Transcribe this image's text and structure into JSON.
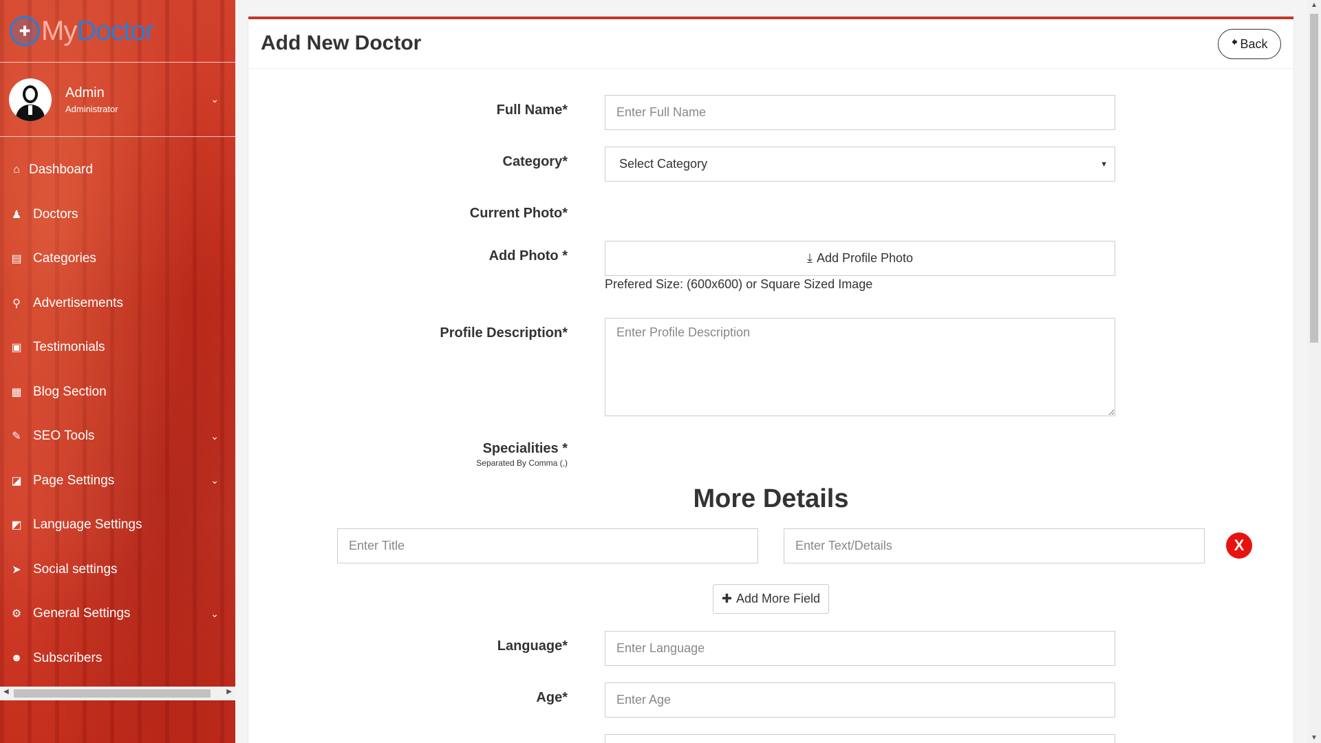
{
  "brand": {
    "logo_part1": "My",
    "logo_part2": "Doctor"
  },
  "user": {
    "name": "Admin",
    "role": "Administrator"
  },
  "sidebar": {
    "items": [
      {
        "label": "Dashboard",
        "icon": "home-icon",
        "glyph": "⌂",
        "has_arrow": false
      },
      {
        "label": "Doctors",
        "icon": "doctor-icon",
        "glyph": "♟",
        "has_arrow": false
      },
      {
        "label": "Categories",
        "icon": "clipboard-icon",
        "glyph": "▤",
        "has_arrow": false
      },
      {
        "label": "Advertisements",
        "icon": "link-icon",
        "glyph": "⚲",
        "has_arrow": false
      },
      {
        "label": "Testimonials",
        "icon": "image-icon",
        "glyph": "▣",
        "has_arrow": false
      },
      {
        "label": "Blog Section",
        "icon": "file-icon",
        "glyph": "▦",
        "has_arrow": false
      },
      {
        "label": "SEO Tools",
        "icon": "wrench-icon",
        "glyph": "✎",
        "has_arrow": true
      },
      {
        "label": "Page Settings",
        "icon": "code-file-icon",
        "glyph": "◪",
        "has_arrow": true
      },
      {
        "label": "Language Settings",
        "icon": "language-icon",
        "glyph": "◩",
        "has_arrow": false
      },
      {
        "label": "Social settings",
        "icon": "paper-plane-icon",
        "glyph": "➤",
        "has_arrow": false
      },
      {
        "label": "General Settings",
        "icon": "cogs-icon",
        "glyph": "⚙",
        "has_arrow": true
      },
      {
        "label": "Subscribers",
        "icon": "users-icon",
        "glyph": "☻",
        "has_arrow": false
      }
    ]
  },
  "page": {
    "title": "Add New Doctor",
    "back_label": "Back"
  },
  "form": {
    "full_name": {
      "label": "Full Name*",
      "placeholder": "Enter Full Name",
      "value": ""
    },
    "category": {
      "label": "Category*",
      "selected": "Select Category"
    },
    "current_photo": {
      "label": "Current Photo*"
    },
    "add_photo": {
      "label": "Add Photo *",
      "button": "Add Profile Photo",
      "hint": "Prefered Size: (600x600) or Square Sized Image"
    },
    "profile_description": {
      "label": "Profile Description*",
      "placeholder": "Enter Profile Description"
    },
    "specialities": {
      "label": "Specialities *",
      "sublabel": "Separated By Comma (,)"
    },
    "more_details": {
      "heading": "More Details",
      "title_placeholder": "Enter Title",
      "details_placeholder": "Enter Text/Details",
      "remove_label": "X",
      "add_more_label": "Add More Field"
    },
    "language": {
      "label": "Language*",
      "placeholder": "Enter Language"
    },
    "age": {
      "label": "Age*",
      "placeholder": "Enter Age"
    }
  },
  "colors": {
    "accent": "#c0392b",
    "sidebar": "#d1412c",
    "danger": "#e8120f",
    "brand_blue": "#2b7cd3"
  }
}
